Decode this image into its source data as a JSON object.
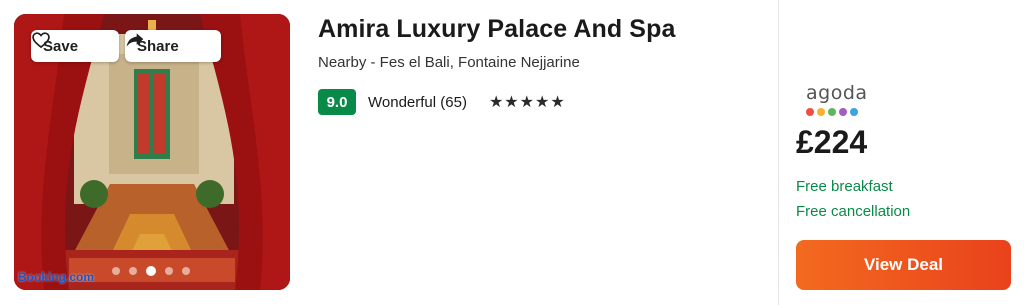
{
  "hotel": {
    "name": "Amira Luxury Palace And Spa",
    "location": "Nearby - Fes el Bali, Fontaine Nejjarine",
    "score": "9.0",
    "rating_label": "Wonderful (65)",
    "stars": "★★★★★",
    "star_count": 5
  },
  "photo": {
    "save_label": "Save",
    "share_label": "Share",
    "watermark": "Booking.com",
    "carousel_dots": 5,
    "active_dot": 3
  },
  "deal": {
    "provider": "agoda",
    "provider_dot_colors": [
      "#f04e45",
      "#f7b32b",
      "#5cb85c",
      "#a35dbe",
      "#3aa3e3"
    ],
    "price": "£224",
    "perks": [
      "Free breakfast",
      "Free cancellation"
    ],
    "cta_label": "View Deal"
  },
  "colors": {
    "score_badge": "#0a8a49",
    "perk_text": "#0a8a49",
    "cta_start": "#f36a1f",
    "cta_end": "#e9421c"
  }
}
